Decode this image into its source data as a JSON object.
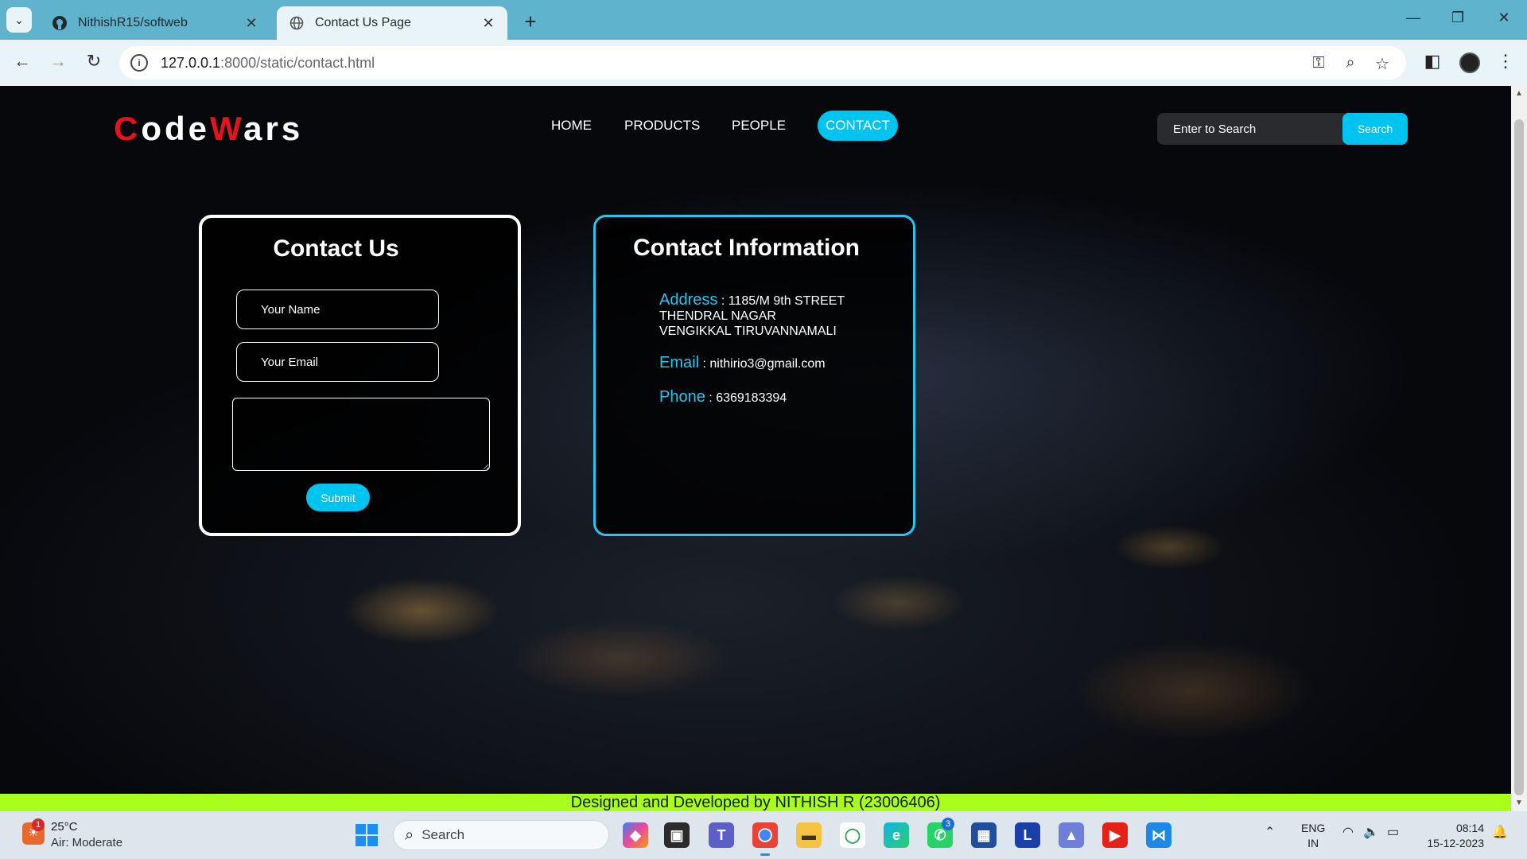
{
  "browser": {
    "tabs": [
      {
        "title": "NithishR15/softweb",
        "active": false
      },
      {
        "title": "Contact Us Page",
        "active": true
      }
    ],
    "url_host": "127.0.0.1",
    "url_path": ":8000/static/contact.html"
  },
  "site": {
    "logo_first": "C",
    "logo_mid1": "ode",
    "logo_mid2": "W",
    "logo_last": "ars",
    "nav": [
      "HOME",
      "PRODUCTS",
      "PEOPLE",
      "CONTACT"
    ],
    "active_nav": "CONTACT",
    "search_placeholder": "Enter to Search",
    "search_button": "Search"
  },
  "contact_form": {
    "title": "Contact Us",
    "name_placeholder": "Your Name",
    "email_placeholder": "Your Email",
    "message_value": "",
    "submit_label": "Submit"
  },
  "contact_info": {
    "title": "Contact Information",
    "address_label": "Address",
    "address_line1": "1185/M 9th STREET",
    "address_line2": "THENDRAL NAGAR",
    "address_line3": "VENGIKKAL TIRUVANNAMALI",
    "email_label": "Email",
    "email_value": "nithirio3@gmail.com",
    "phone_label": "Phone",
    "phone_value": "6369183394",
    "separator": " : "
  },
  "footer": {
    "text": "Designed and Developed by NITHISH R (23006406)"
  },
  "taskbar": {
    "temperature": "25°C",
    "air_quality": "Air: Moderate",
    "weather_badge": "1",
    "search_label": "Search",
    "whatsapp_badge": "3",
    "lang_line1": "ENG",
    "lang_line2": "IN",
    "time": "08:14",
    "date": "15-12-2023"
  },
  "colors": {
    "accent": "#00c4f0",
    "logo_red": "#e8121d",
    "footer_green": "#a8ff1a"
  }
}
